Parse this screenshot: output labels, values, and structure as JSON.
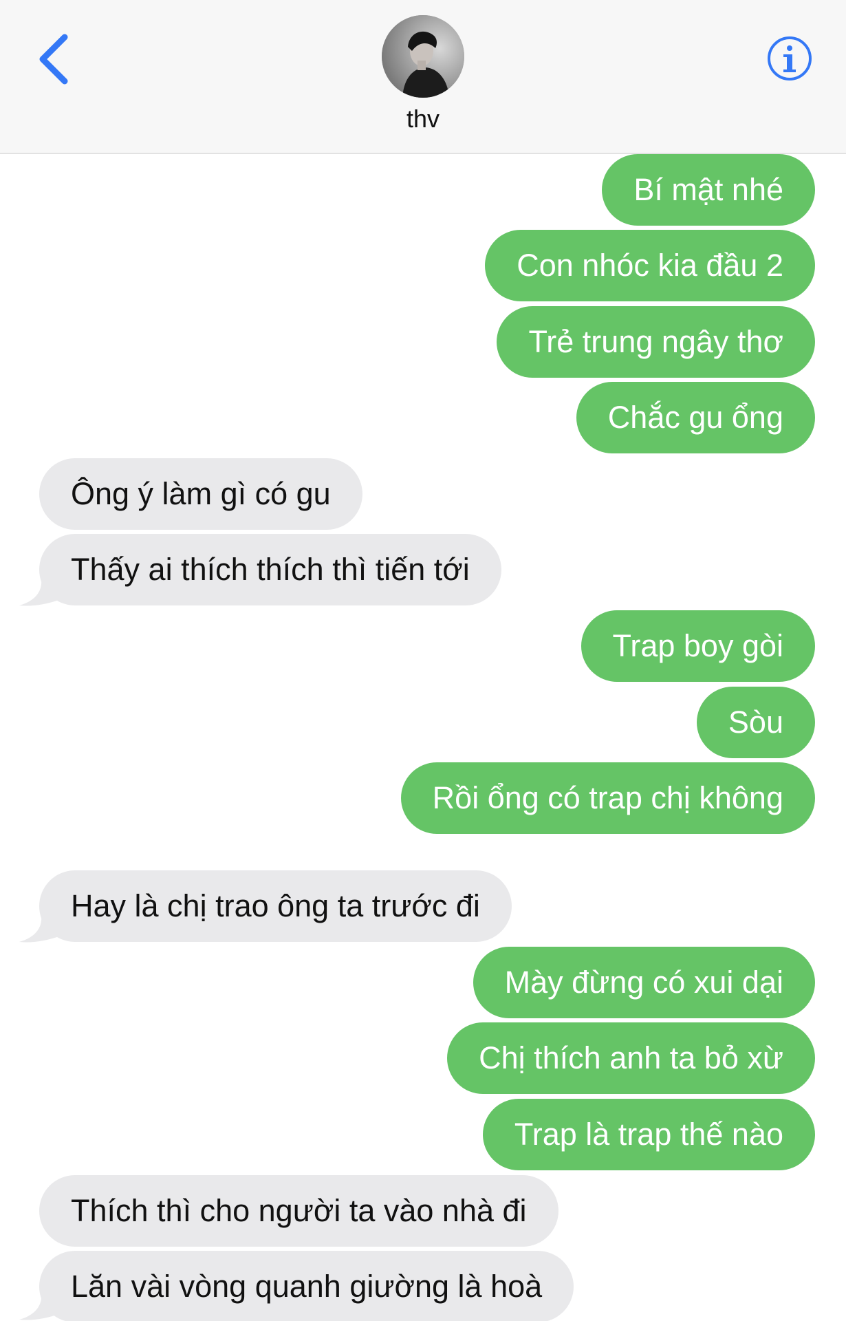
{
  "header": {
    "contact_name": "thv",
    "accent_color": "#3478f6",
    "back_icon": "chevron-left-icon",
    "info_icon": "info-circle-icon"
  },
  "colors": {
    "outgoing_bubble": "#65c466",
    "incoming_bubble": "#e9e9eb",
    "outgoing_text": "#ffffff",
    "incoming_text": "#111111"
  },
  "messages": [
    {
      "direction": "out",
      "text": "Bí mật nhé"
    },
    {
      "direction": "out",
      "text": "Con nhóc kia đầu 2"
    },
    {
      "direction": "out",
      "text": "Trẻ trung ngây thơ"
    },
    {
      "direction": "out",
      "text": "Chắc gu ổng"
    },
    {
      "direction": "in",
      "text": "Ông ý làm gì có gu"
    },
    {
      "direction": "in",
      "text": "Thấy ai thích thích thì tiến tới"
    },
    {
      "direction": "out",
      "text": "Trap boy gòi"
    },
    {
      "direction": "out",
      "text": "Sòu"
    },
    {
      "direction": "out",
      "text": "Rồi ổng có trap chị không"
    },
    {
      "direction": "in",
      "text": "Hay là chị trao ông ta trước đi"
    },
    {
      "direction": "out",
      "text": "Mày đừng có xui dại"
    },
    {
      "direction": "out",
      "text": "Chị thích anh ta bỏ xừ"
    },
    {
      "direction": "out",
      "text": "Trap là trap thế nào"
    },
    {
      "direction": "in",
      "text": "Thích thì cho người ta vào nhà đi"
    },
    {
      "direction": "in",
      "text": "Lăn vài vòng quanh giường là hoà"
    }
  ]
}
